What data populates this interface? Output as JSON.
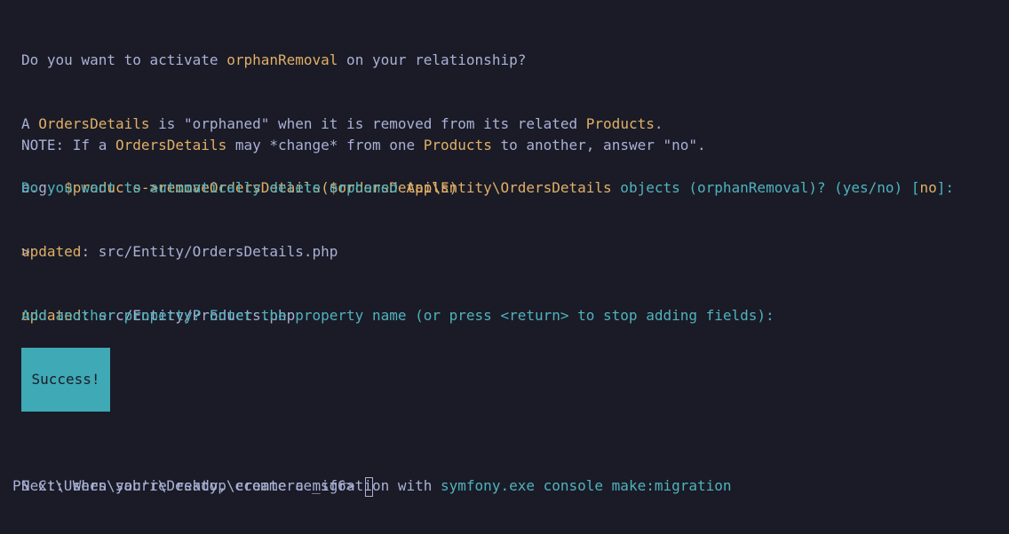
{
  "lines": {
    "l1": {
      "a": "Do you want to activate ",
      "b": "orphanRemoval",
      "c": " on your relationship?"
    },
    "l2": {
      "a": "A ",
      "b": "OrdersDetails",
      "c": " is \"orphaned\" when it is removed from its related ",
      "d": "Products",
      "e": "."
    },
    "l3": {
      "a": "e.g. ",
      "b": "$products->removeOrdersDetails($ordersDetails)"
    },
    "l4": {
      "a": "NOTE: If a ",
      "b": "OrdersDetails",
      "c": " may *change* from one ",
      "d": "Products",
      "e": " to another, answer \"no\"."
    },
    "l5": {
      "a": "Do you want to automatically delete orphaned ",
      "b": "App\\Entity\\OrdersDetails",
      "c": " objects (orphanRemoval)? (yes/no) [",
      "d": "no",
      "e": "]:"
    },
    "l6": ">",
    "l7": {
      "a": "updated",
      "b": ": src/Entity/OrdersDetails.php"
    },
    "l8": {
      "a": "updated",
      "b": ": src/Entity/Products.php"
    },
    "l9": "Add another property? Enter the property name (or press <return> to stop adding fields):",
    "l10": ">",
    "success": "Success!",
    "next": {
      "a": "Next: When you're ready, create a migration with ",
      "b": "symfony.exe console make:migration"
    },
    "prompt": "PS C:\\Users\\sabri\\Desktop\\ecommerce_sf6> "
  },
  "colors": {
    "background": "#1a1b26",
    "text": "#a9b1d6",
    "highlight": "#e0af68",
    "accent": "#4fb3bf",
    "success_bg": "#3fa9b6"
  }
}
